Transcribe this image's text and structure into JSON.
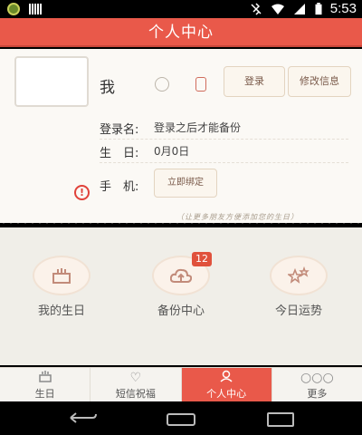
{
  "status_bar": {
    "time": "5:53"
  },
  "header": {
    "title": "个人中心"
  },
  "profile": {
    "nickname": "我",
    "login_button": "登录",
    "edit_button": "修改信息",
    "username_label": "登录名:",
    "username_value": "登录之后才能备份",
    "birthday_label": "生　日:",
    "birthday_value": "0月0日",
    "phone_label": "手　机:",
    "bind_button": "立即绑定",
    "hint_text": "（让更多朋友方便添加您的生日）"
  },
  "features": {
    "items": [
      {
        "label": "我的生日",
        "icon": "cake-icon"
      },
      {
        "label": "备份中心",
        "icon": "cloud-upload-icon",
        "badge": "12"
      },
      {
        "label": "今日运势",
        "icon": "stars-icon"
      }
    ]
  },
  "tabbar": {
    "tabs": [
      {
        "label": "生日",
        "icon": "cake-icon"
      },
      {
        "label": "短信祝福",
        "icon": "heart-icon"
      },
      {
        "label": "个人中心",
        "icon": "person-icon",
        "active": true
      },
      {
        "label": "更多",
        "icon": "more-icon"
      }
    ]
  },
  "colors": {
    "accent": "#e9594a",
    "badge": "#e0513c",
    "warning": "#e0423a"
  }
}
